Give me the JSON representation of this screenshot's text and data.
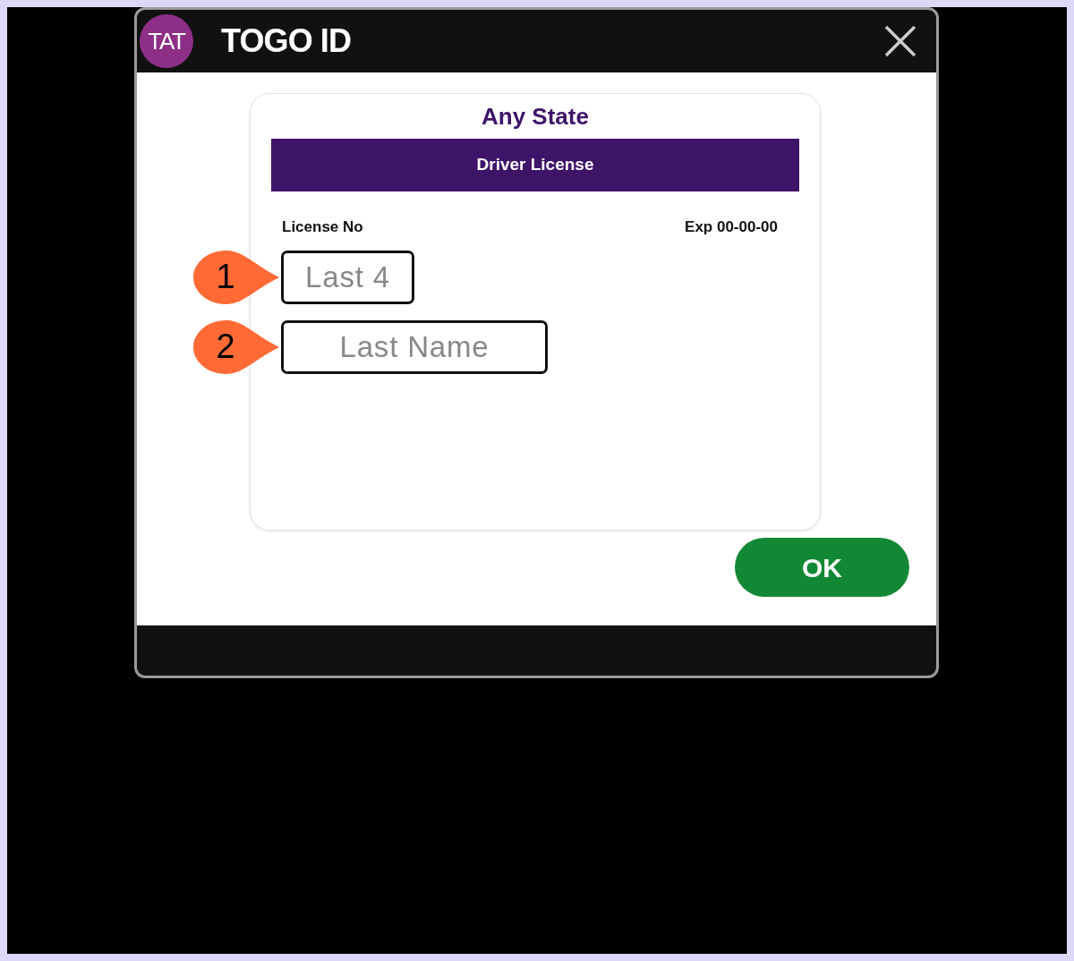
{
  "window": {
    "logo": "TAT",
    "title": "TOGO ID"
  },
  "card": {
    "state": "Any State",
    "document": "Driver License",
    "license_label": "License No",
    "expiry": "Exp 00-00-00",
    "fields": [
      {
        "marker": "1",
        "placeholder": "Last 4"
      },
      {
        "marker": "2",
        "placeholder": "Last Name"
      }
    ]
  },
  "buttons": [
    "OK"
  ]
}
